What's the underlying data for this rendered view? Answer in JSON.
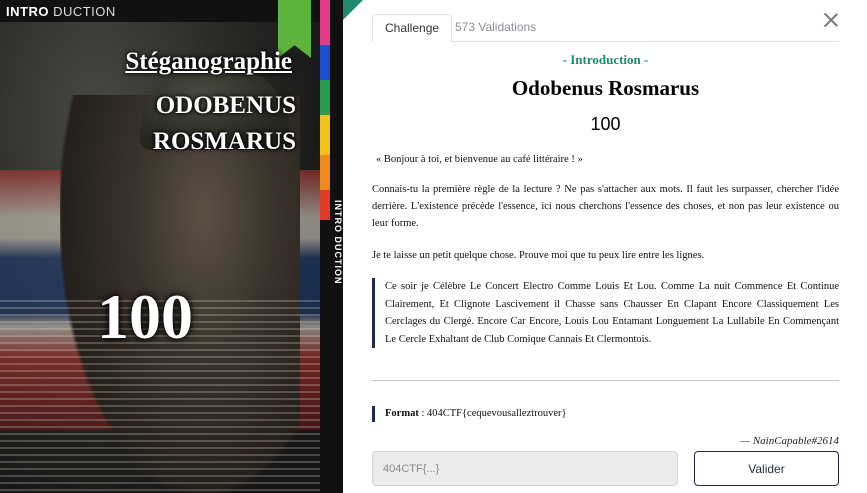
{
  "poster": {
    "brand_bold": "INTRO",
    "brand_light": " DUCTION",
    "category": "Stéganographie",
    "title_line1": "ODOBENUS",
    "title_line2": "ROSMARUS",
    "points": "100",
    "vertical_text": "INTRO DUCTION",
    "stripe_colors": [
      "#e63a8a",
      "#1e4fd1",
      "#2a9d4a",
      "#f4c21a",
      "#f08a1a",
      "#e03a2a"
    ],
    "ribbon_color": "#5db33b"
  },
  "tabs": [
    {
      "label": "Challenge"
    },
    {
      "label": "573 Validations"
    }
  ],
  "challenge": {
    "section": "- Introduction -",
    "title": "Odobenus Rosmarus",
    "points": "100",
    "paragraphs": [
      "« Bonjour à toi, et bienvenue au café littéraire ! »",
      "Connais-tu la première règle de la lecture ? Ne pas s'attacher aux mots. Il faut les surpasser, chercher l'idée derrière. L'existence précède l'essence, ici nous cherchons l'essence des choses, et non pas leur existence ou leur forme.",
      "Je te laisse un petit quelque chose. Prouve moi que tu peux lire entre les lignes."
    ],
    "quote": "Ce soir je Célèbre Le Concert Electro Comme Louis Et Lou. Comme La nuit Commence Et Continue Clairement, Et Clignote Lascivement il Chasse sans Chausser En Clapant Encore Classiquement Les Cerclages du Clergé. Encore Car Encore, Louis Lou Entamant Longuement La Lullabile En Commençant Le Cercle Exhaltant de Club Comique Cannais Et Clermontois.",
    "format_label": "Format",
    "format_value": " : 404CTF{cequevousalleztrouver}",
    "author": "— NainCapable#2614"
  },
  "form": {
    "flag_placeholder": "404CTF{...}",
    "submit_label": "Valider"
  },
  "colors": {
    "accent": "#1e8a6e",
    "navy": "#1f2a44"
  }
}
